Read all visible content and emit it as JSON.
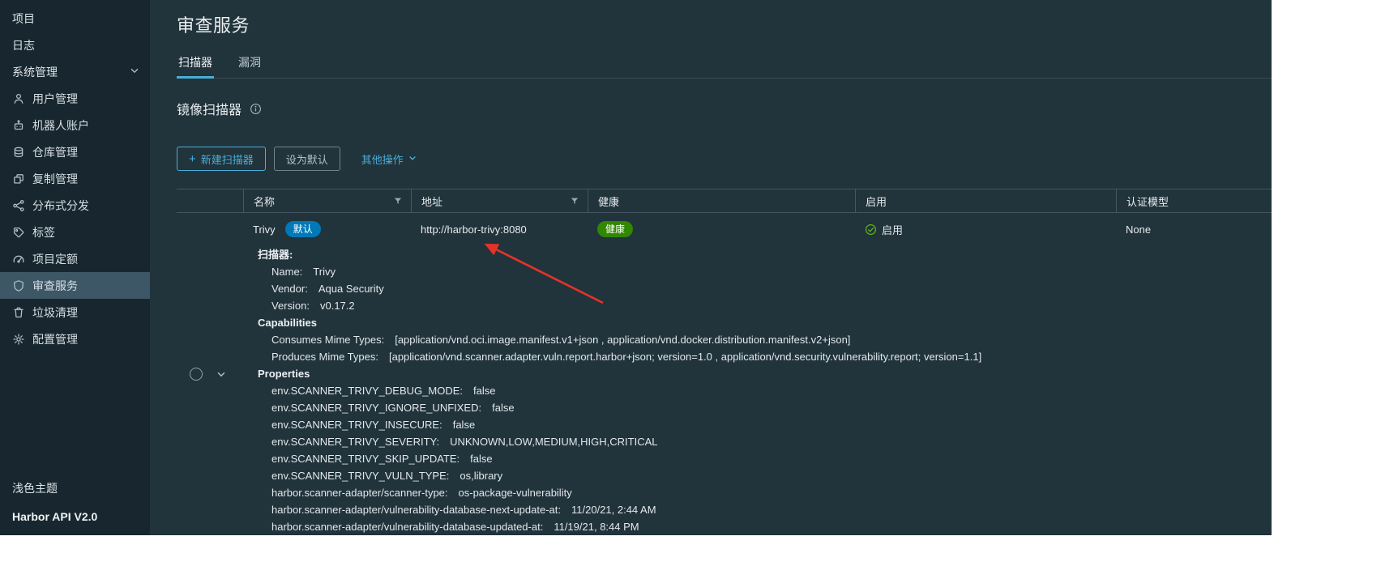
{
  "colors": {
    "accent": "#49afd9",
    "badge_blue": "#0079b8",
    "health_green": "#318700",
    "check_green": "#5eb715",
    "arrow_red": "#e5332a"
  },
  "sidebar": {
    "top_items": [
      {
        "id": "projects",
        "label": "项目"
      },
      {
        "id": "logs",
        "label": "日志"
      }
    ],
    "system_group": {
      "label": "系统管理"
    },
    "system_items": [
      {
        "id": "user-management",
        "icon": "users-icon",
        "label": "用户管理",
        "active": false
      },
      {
        "id": "robot-accounts",
        "icon": "robot-icon",
        "label": "机器人账户",
        "active": false
      },
      {
        "id": "registries",
        "icon": "registry-icon",
        "label": "仓库管理",
        "active": false
      },
      {
        "id": "replications",
        "icon": "replication-icon",
        "label": "复制管理",
        "active": false
      },
      {
        "id": "distribution",
        "icon": "distribution-icon",
        "label": "分布式分发",
        "active": false
      },
      {
        "id": "labels",
        "icon": "tag-icon",
        "label": "标签",
        "active": false
      },
      {
        "id": "project-quotas",
        "icon": "quota-icon",
        "label": "项目定额",
        "active": false
      },
      {
        "id": "interrogation-services",
        "icon": "shield-icon",
        "label": "审查服务",
        "active": true
      },
      {
        "id": "garbage-collection",
        "icon": "trash-icon",
        "label": "垃圾清理",
        "active": false
      },
      {
        "id": "configuration",
        "icon": "gear-icon",
        "label": "配置管理",
        "active": false
      }
    ],
    "footer_items": [
      {
        "id": "light-theme",
        "label": "浅色主题",
        "bold": false
      },
      {
        "id": "harbor-api",
        "label": "Harbor API V2.0",
        "bold": true
      }
    ]
  },
  "page": {
    "title": "审查服务",
    "tabs": [
      {
        "id": "scanners",
        "label": "扫描器",
        "active": true
      },
      {
        "id": "vulnerability",
        "label": "漏洞",
        "active": false
      }
    ],
    "section_title": "镜像扫描器",
    "toolbar": {
      "new_scanner": "新建扫描器",
      "set_default": "设为默认",
      "other_actions": "其他操作"
    }
  },
  "table": {
    "columns": [
      {
        "label": "名称",
        "filter": true
      },
      {
        "label": "地址",
        "filter": true
      },
      {
        "label": "健康",
        "filter": false
      },
      {
        "label": "启用",
        "filter": false
      },
      {
        "label": "认证模型",
        "filter": false
      }
    ],
    "row": {
      "name": "Trivy",
      "default_badge": "默认",
      "address": "http://harbor-trivy:8080",
      "health": "健康",
      "enabled": "启用",
      "auth_model": "None"
    },
    "details": [
      {
        "indent": 1,
        "key": "扫描器:",
        "value": "",
        "bold": true
      },
      {
        "indent": 2,
        "key": "Name:",
        "value": "Trivy",
        "bold": false
      },
      {
        "indent": 2,
        "key": "Vendor:",
        "value": "Aqua Security",
        "bold": false
      },
      {
        "indent": 2,
        "key": "Version:",
        "value": "v0.17.2",
        "bold": false
      },
      {
        "indent": 1,
        "key": "Capabilities",
        "value": "",
        "bold": true
      },
      {
        "indent": 2,
        "key": "Consumes Mime Types:",
        "value": "[application/vnd.oci.image.manifest.v1+json , application/vnd.docker.distribution.manifest.v2+json]",
        "bold": false
      },
      {
        "indent": 2,
        "key": "Produces Mime Types:",
        "value": "[application/vnd.scanner.adapter.vuln.report.harbor+json; version=1.0 , application/vnd.security.vulnerability.report; version=1.1]",
        "bold": false
      },
      {
        "indent": 1,
        "key": "Properties",
        "value": "",
        "bold": true
      },
      {
        "indent": 2,
        "key": "env.SCANNER_TRIVY_DEBUG_MODE:",
        "value": "false",
        "bold": false
      },
      {
        "indent": 2,
        "key": "env.SCANNER_TRIVY_IGNORE_UNFIXED:",
        "value": "false",
        "bold": false
      },
      {
        "indent": 2,
        "key": "env.SCANNER_TRIVY_INSECURE:",
        "value": "false",
        "bold": false
      },
      {
        "indent": 2,
        "key": "env.SCANNER_TRIVY_SEVERITY:",
        "value": "UNKNOWN,LOW,MEDIUM,HIGH,CRITICAL",
        "bold": false
      },
      {
        "indent": 2,
        "key": "env.SCANNER_TRIVY_SKIP_UPDATE:",
        "value": "false",
        "bold": false
      },
      {
        "indent": 2,
        "key": "env.SCANNER_TRIVY_VULN_TYPE:",
        "value": "os,library",
        "bold": false
      },
      {
        "indent": 2,
        "key": "harbor.scanner-adapter/scanner-type:",
        "value": "os-package-vulnerability",
        "bold": false
      },
      {
        "indent": 2,
        "key": "harbor.scanner-adapter/vulnerability-database-next-update-at:",
        "value": "11/20/21, 2:44 AM",
        "bold": false
      },
      {
        "indent": 2,
        "key": "harbor.scanner-adapter/vulnerability-database-updated-at:",
        "value": "11/19/21, 8:44 PM",
        "bold": false
      }
    ]
  }
}
